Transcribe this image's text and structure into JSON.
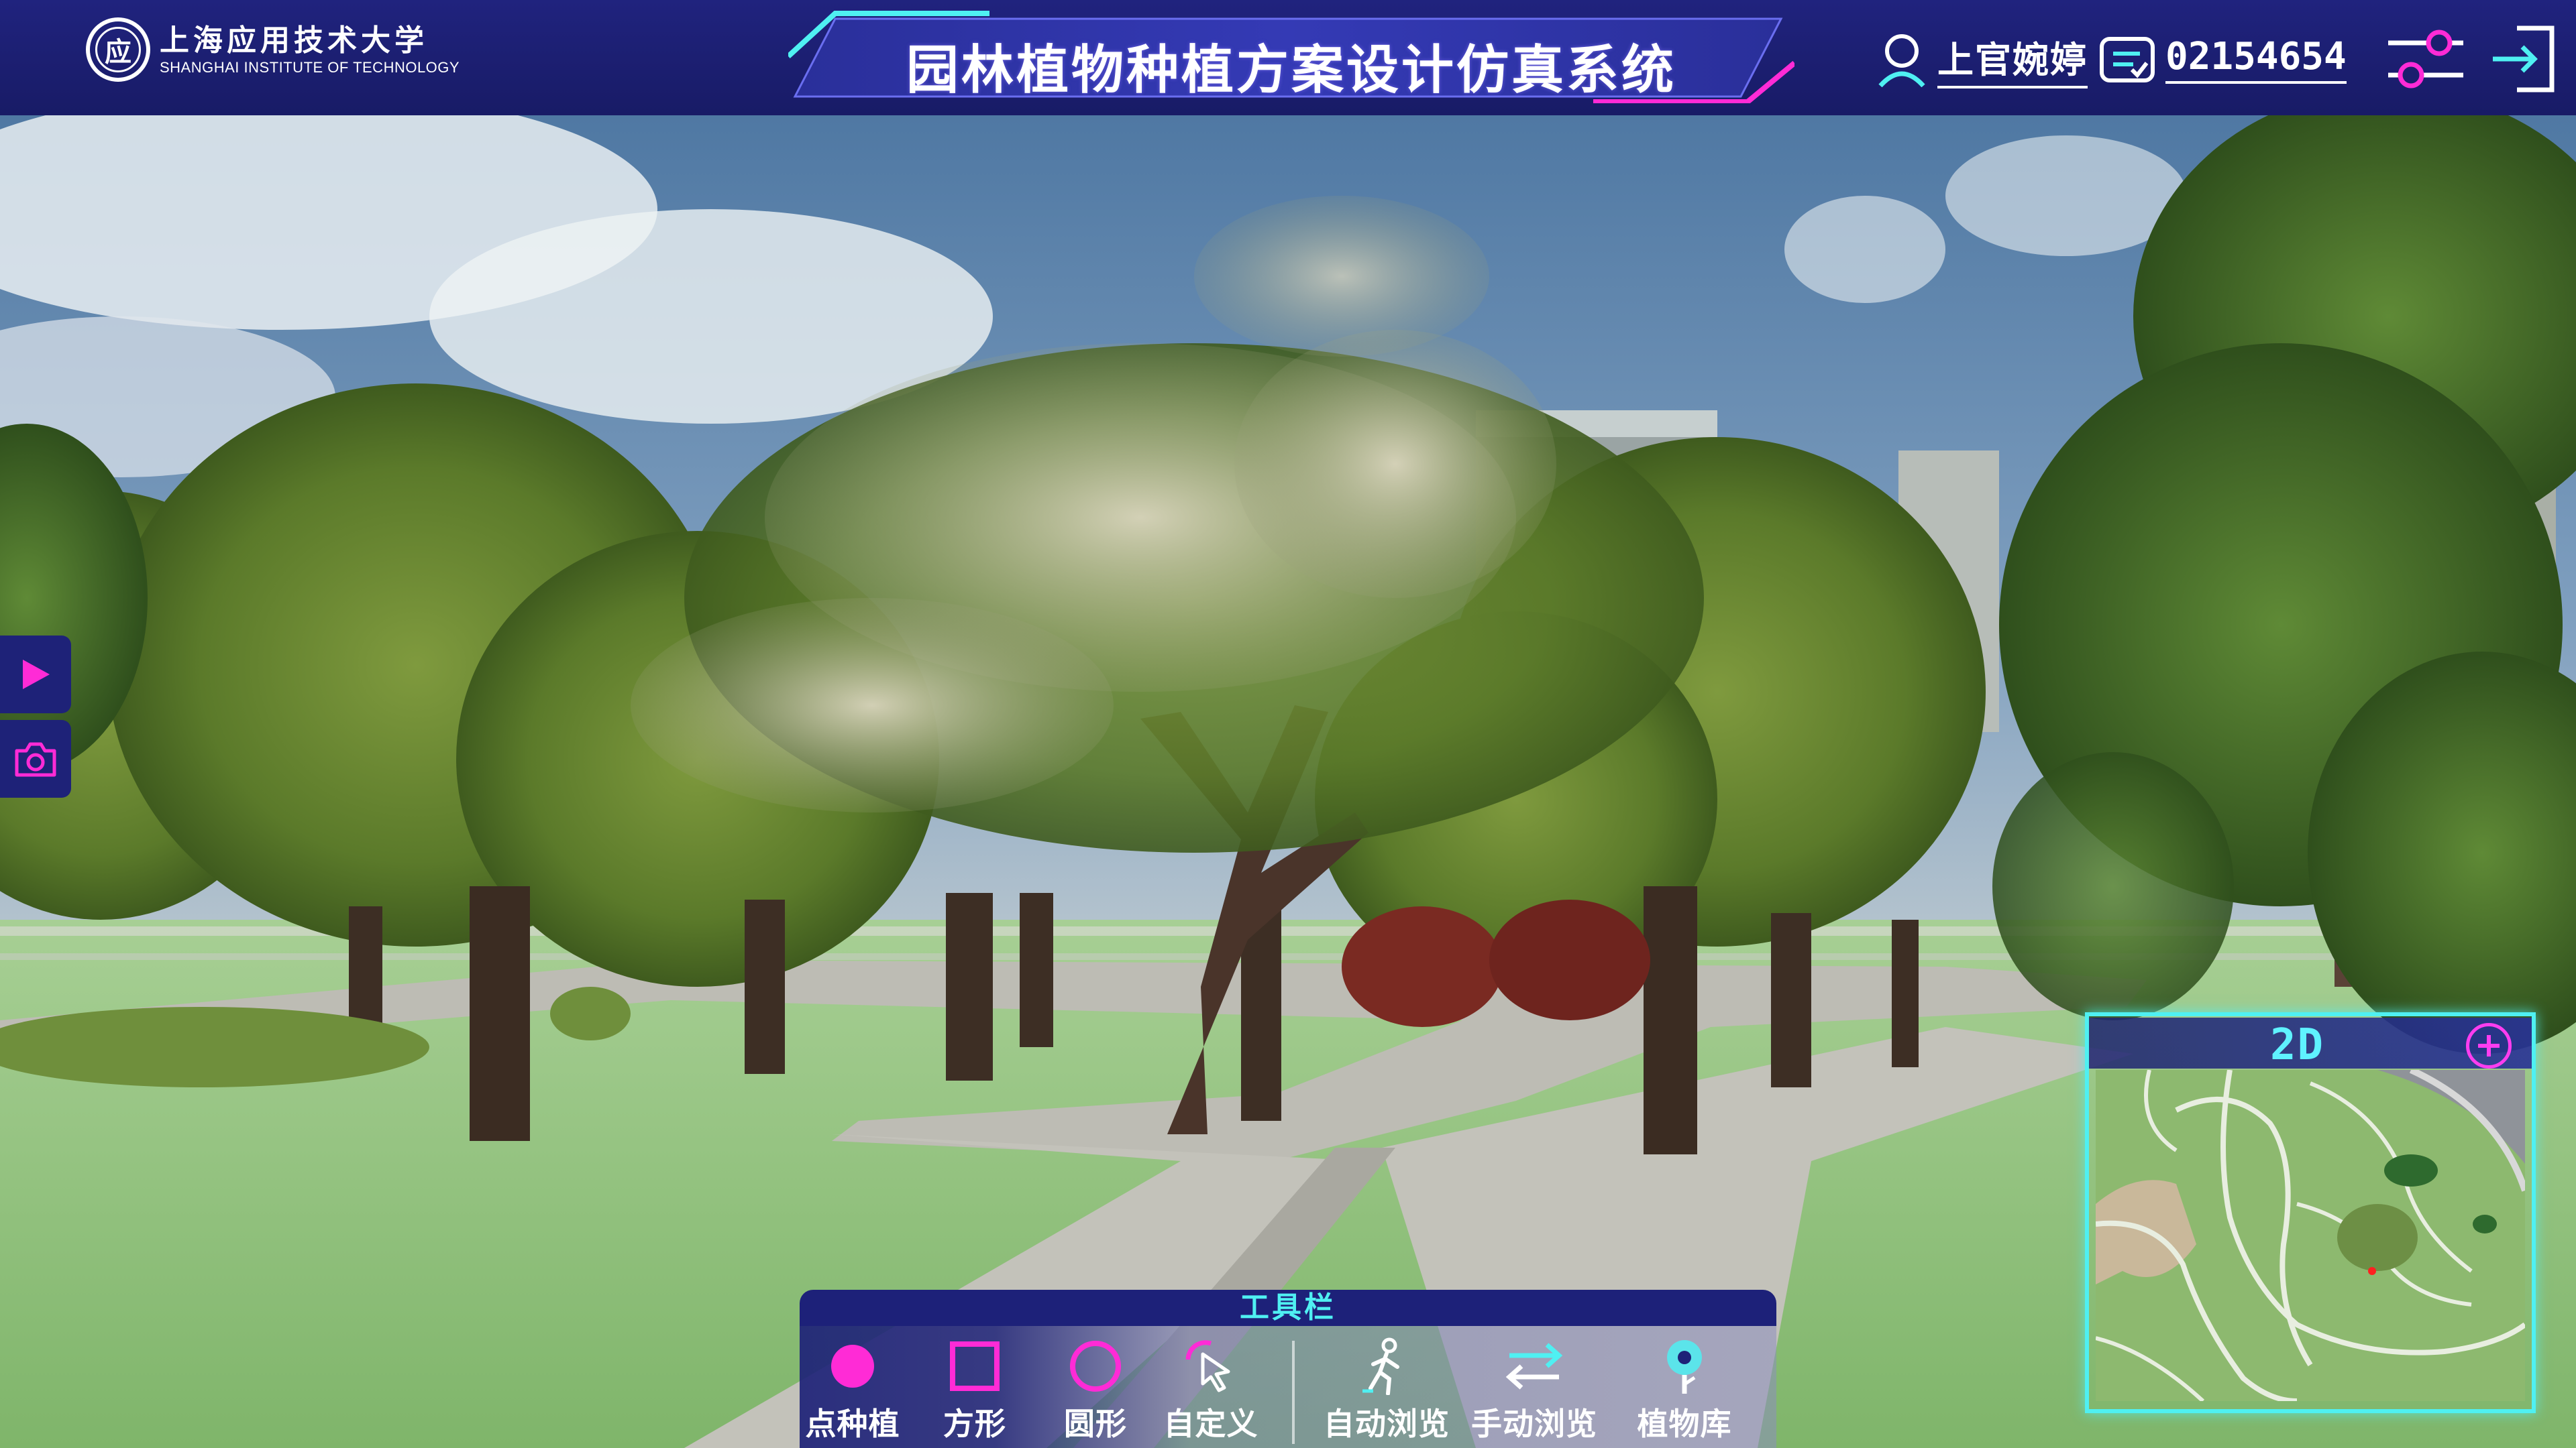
{
  "header": {
    "logo": {
      "seal_glyph": "应",
      "name_cn": "上海应用技术大学",
      "name_en": "SHANGHAI INSTITUTE OF TECHNOLOGY"
    },
    "title": "园林植物种植方案设计仿真系统",
    "user": {
      "name": "上官婉婷",
      "id": "02154654"
    },
    "icons": [
      "user-icon",
      "id-card-icon",
      "settings-sliders-icon",
      "exit-icon"
    ]
  },
  "side_buttons": [
    "play-icon",
    "camera-icon"
  ],
  "minimap": {
    "mode": "2D",
    "zoom_icon": "plus-circle-icon"
  },
  "toolbar": {
    "title": "工具栏",
    "tools": [
      {
        "label": "点种植",
        "icon": "point-plant-icon"
      },
      {
        "label": "方形",
        "icon": "square-icon"
      },
      {
        "label": "圆形",
        "icon": "circle-icon"
      },
      {
        "label": "自定义",
        "icon": "custom-cursor-icon"
      },
      {
        "label": "自动浏览",
        "icon": "auto-walk-icon"
      },
      {
        "label": "手动浏览",
        "icon": "manual-browse-icon"
      },
      {
        "label": "植物库",
        "icon": "plant-library-icon"
      }
    ]
  },
  "colors": {
    "header_bg": "#1b1e6e",
    "accent_cyan": "#4ff0f2",
    "accent_magenta": "#ff2bd6",
    "grass": "#8fc27a",
    "path": "#bdbcb4",
    "sky": "#5e84ad"
  }
}
